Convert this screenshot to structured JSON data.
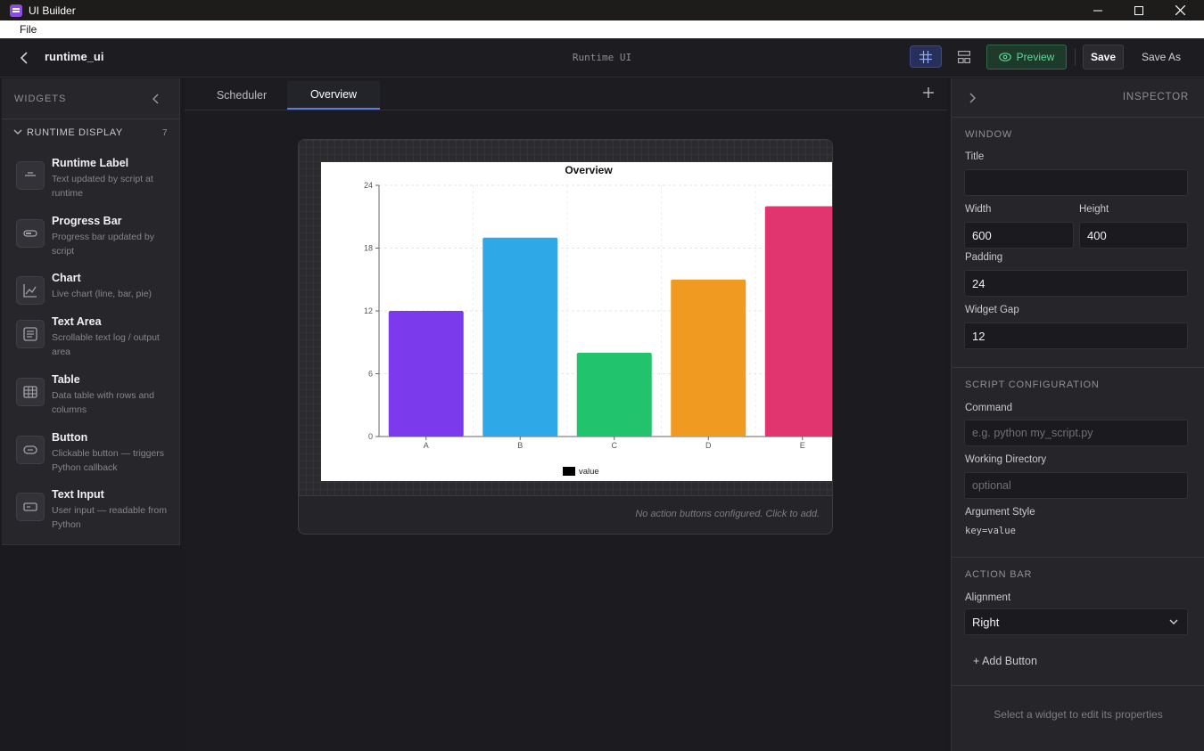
{
  "window": {
    "title": "UI Builder",
    "minimize": "—",
    "maximize": "☐",
    "close": "✕"
  },
  "menu": {
    "file": "File"
  },
  "header": {
    "project_name": "runtime_ui",
    "center_title": "Runtime UI",
    "preview_label": "Preview",
    "save_label": "Save",
    "save_as_label": "Save As"
  },
  "widgets_panel": {
    "title": "WIDGETS",
    "section": {
      "title": "RUNTIME DISPLAY",
      "count": "7"
    },
    "items": [
      {
        "name": "Runtime Label",
        "desc": "Text updated by script at runtime",
        "icon": "label-icon"
      },
      {
        "name": "Progress Bar",
        "desc": "Progress bar updated by script",
        "icon": "progress-bar-icon"
      },
      {
        "name": "Chart",
        "desc": "Live chart (line, bar, pie)",
        "icon": "chart-icon"
      },
      {
        "name": "Text Area",
        "desc": "Scrollable text log / output area",
        "icon": "text-area-icon"
      },
      {
        "name": "Table",
        "desc": "Data table with rows and columns",
        "icon": "table-icon"
      },
      {
        "name": "Button",
        "desc": "Clickable button — triggers Python callback",
        "icon": "button-icon"
      },
      {
        "name": "Text Input",
        "desc": "User input — readable from Python",
        "icon": "text-input-icon"
      }
    ]
  },
  "tabs": [
    {
      "label": "Scheduler"
    },
    {
      "label": "Overview"
    }
  ],
  "active_tab": "Overview",
  "canvas": {
    "action_hint": "No action buttons configured. Click to add."
  },
  "chart_data": {
    "type": "bar",
    "title": "Overview",
    "categories": [
      "A",
      "B",
      "C",
      "D",
      "E"
    ],
    "series": [
      {
        "name": "value",
        "values": [
          12,
          19,
          8,
          15,
          22
        ]
      }
    ],
    "colors": [
      "#7c3aed",
      "#2ea8e6",
      "#21c46d",
      "#f19a22",
      "#e0356f"
    ],
    "ylim": [
      0,
      24
    ],
    "yticks": [
      0,
      6,
      12,
      18,
      24
    ],
    "grid": true,
    "legend": "bottom"
  },
  "inspector": {
    "title": "INSPECTOR",
    "window_section": "WINDOW",
    "title_label": "Title",
    "title_value": "",
    "width_label": "Width",
    "width_value": "600",
    "height_label": "Height",
    "height_value": "400",
    "padding_label": "Padding",
    "padding_value": "24",
    "gap_label": "Widget Gap",
    "gap_value": "12",
    "script_section": "SCRIPT CONFIGURATION",
    "command_label": "Command",
    "command_placeholder": "e.g. python my_script.py",
    "workdir_label": "Working Directory",
    "workdir_placeholder": "optional",
    "argstyle_label": "Argument Style",
    "argstyle_value": "key=value",
    "actionbar_section": "ACTION BAR",
    "alignment_label": "Alignment",
    "alignment_value": "Right",
    "add_button_label": "+ Add Button",
    "hint": "Select a widget to edit its properties"
  }
}
